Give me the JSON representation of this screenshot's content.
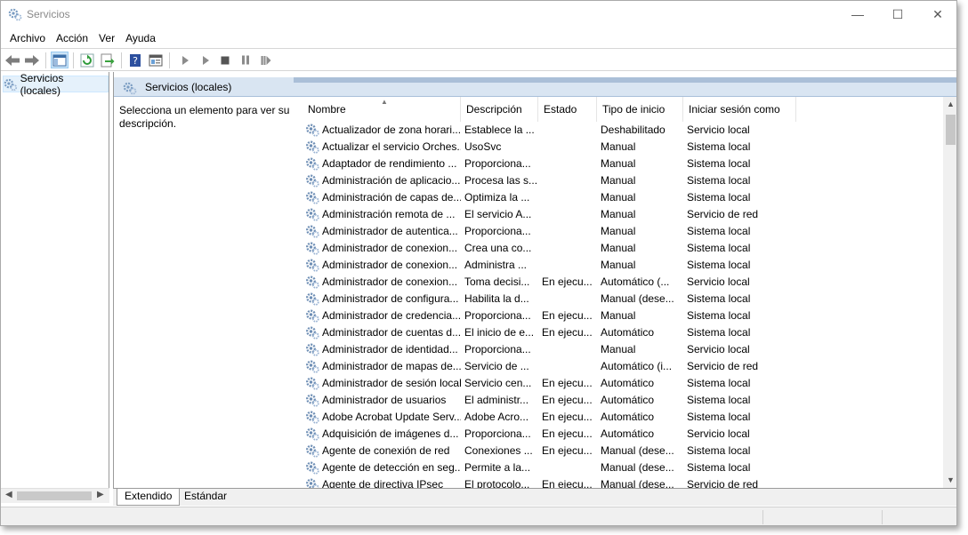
{
  "window": {
    "title": "Servicios",
    "controls": {
      "minimize": "—",
      "maximize": "☐",
      "close": "✕"
    }
  },
  "menu": [
    "Archivo",
    "Acción",
    "Ver",
    "Ayuda"
  ],
  "toolbar": {
    "icons": [
      "back-arrow-icon",
      "forward-arrow-icon",
      "show-hide-tree-icon",
      "refresh-icon",
      "export-list-icon",
      "help-icon",
      "properties-icon",
      "play-icon",
      "play-outline-icon",
      "stop-icon",
      "pause-icon",
      "resume-icon"
    ]
  },
  "tree": {
    "root_label": "Servicios (locales)"
  },
  "panel": {
    "title": "Servicios (locales)",
    "description": "Selecciona un elemento para ver su descripción."
  },
  "columns": [
    "Nombre",
    "Descripción",
    "Estado",
    "Tipo de inicio",
    "Iniciar sesión como"
  ],
  "rows": [
    [
      "Actualizador de zona horari...",
      "Establece la ...",
      "",
      "Deshabilitado",
      "Servicio local"
    ],
    [
      "Actualizar el servicio Orches...",
      "UsoSvc",
      "",
      "Manual",
      "Sistema local"
    ],
    [
      "Adaptador de rendimiento ...",
      "Proporciona...",
      "",
      "Manual",
      "Sistema local"
    ],
    [
      "Administración de aplicacio...",
      "Procesa las s...",
      "",
      "Manual",
      "Sistema local"
    ],
    [
      "Administración de capas de...",
      "Optimiza la ...",
      "",
      "Manual",
      "Sistema local"
    ],
    [
      "Administración remota de ...",
      "El servicio A...",
      "",
      "Manual",
      "Servicio de red"
    ],
    [
      "Administrador de autentica...",
      "Proporciona...",
      "",
      "Manual",
      "Sistema local"
    ],
    [
      "Administrador de conexion...",
      "Crea una co...",
      "",
      "Manual",
      "Sistema local"
    ],
    [
      "Administrador de conexion...",
      "Administra ...",
      "",
      "Manual",
      "Sistema local"
    ],
    [
      "Administrador de conexion...",
      "Toma decisi...",
      "En ejecu...",
      "Automático (...",
      "Servicio local"
    ],
    [
      "Administrador de configura...",
      "Habilita la d...",
      "",
      "Manual (dese...",
      "Sistema local"
    ],
    [
      "Administrador de credencia...",
      "Proporciona...",
      "En ejecu...",
      "Manual",
      "Sistema local"
    ],
    [
      "Administrador de cuentas d...",
      "El inicio de e...",
      "En ejecu...",
      "Automático",
      "Sistema local"
    ],
    [
      "Administrador de identidad...",
      "Proporciona...",
      "",
      "Manual",
      "Servicio local"
    ],
    [
      "Administrador de mapas de...",
      "Servicio de ...",
      "",
      "Automático (i...",
      "Servicio de red"
    ],
    [
      "Administrador de sesión local",
      "Servicio cen...",
      "En ejecu...",
      "Automático",
      "Sistema local"
    ],
    [
      "Administrador de usuarios",
      "El administr...",
      "En ejecu...",
      "Automático",
      "Sistema local"
    ],
    [
      "Adobe Acrobat Update Serv...",
      "Adobe Acro...",
      "En ejecu...",
      "Automático",
      "Sistema local"
    ],
    [
      "Adquisición de imágenes d...",
      "Proporciona...",
      "En ejecu...",
      "Automático",
      "Servicio local"
    ],
    [
      "Agente de conexión de red",
      "Conexiones ...",
      "En ejecu...",
      "Manual (dese...",
      "Sistema local"
    ],
    [
      "Agente de detección en seg...",
      "Permite a la...",
      "",
      "Manual (dese...",
      "Sistema local"
    ],
    [
      "Agente de directiva IPsec",
      "El protocolo...",
      "En ejecu...",
      "Manual (dese...",
      "Servicio de red"
    ]
  ],
  "tabs": [
    "Extendido",
    "Estándar"
  ],
  "colors": {
    "panel_header": "#d9e5f2",
    "tree_selected": "#e5f1fb",
    "accent": "#2b579a"
  }
}
